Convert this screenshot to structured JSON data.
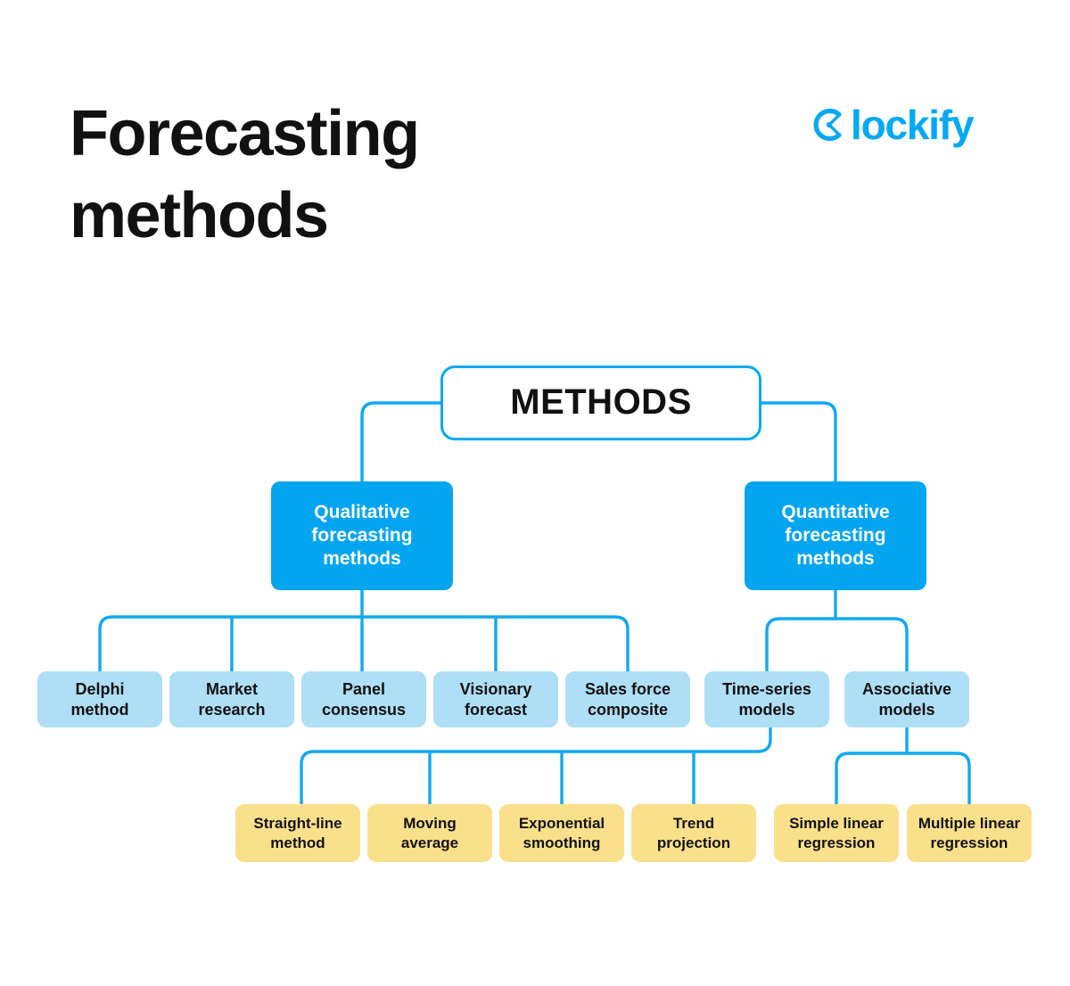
{
  "header": {
    "title": "Forecasting\nmethods",
    "brand": {
      "logo_icon": "clockify-clock-icon",
      "wordmark": "lockify",
      "color": "#03A9F4"
    }
  },
  "theme": {
    "accent_blue": "#03A9F4",
    "node_blue": "#03A5F0",
    "node_light_blue": "#AEDFF7",
    "node_yellow": "#FBE08C",
    "text_dark": "#111111",
    "text_light": "#FFFFFF",
    "background": "#FFFFFF"
  },
  "chart_data": {
    "type": "diagram",
    "diagram_kind": "tree",
    "title": "Forecasting methods",
    "root": "METHODS",
    "levels": [
      {
        "level": 1,
        "style": "outlined-white",
        "nodes": [
          "METHODS"
        ]
      },
      {
        "level": 2,
        "style": "solid-blue",
        "nodes": [
          "Qualitative forecasting methods",
          "Quantitative forecasting methods"
        ]
      },
      {
        "level": 3,
        "style": "light-blue",
        "nodes": [
          "Delphi method",
          "Market research",
          "Panel consensus",
          "Visionary forecast",
          "Sales force composite",
          "Time-series models",
          "Associative models"
        ]
      },
      {
        "level": 4,
        "style": "yellow",
        "nodes": [
          "Straight-line method",
          "Moving average",
          "Exponential smoothing",
          "Trend projection",
          "Simple linear regression",
          "Multiple linear regression"
        ]
      }
    ],
    "edges": [
      {
        "from": "METHODS",
        "to": "Qualitative forecasting methods"
      },
      {
        "from": "METHODS",
        "to": "Quantitative forecasting methods"
      },
      {
        "from": "Qualitative forecasting methods",
        "to": "Delphi method"
      },
      {
        "from": "Qualitative forecasting methods",
        "to": "Market research"
      },
      {
        "from": "Qualitative forecasting methods",
        "to": "Panel consensus"
      },
      {
        "from": "Qualitative forecasting methods",
        "to": "Visionary forecast"
      },
      {
        "from": "Qualitative forecasting methods",
        "to": "Sales force composite"
      },
      {
        "from": "Quantitative forecasting methods",
        "to": "Time-series models"
      },
      {
        "from": "Quantitative forecasting methods",
        "to": "Associative models"
      },
      {
        "from": "Time-series models",
        "to": "Straight-line method"
      },
      {
        "from": "Time-series models",
        "to": "Moving average"
      },
      {
        "from": "Time-series models",
        "to": "Exponential smoothing"
      },
      {
        "from": "Time-series models",
        "to": "Trend projection"
      },
      {
        "from": "Associative models",
        "to": "Simple linear regression"
      },
      {
        "from": "Associative models",
        "to": "Multiple linear regression"
      }
    ]
  },
  "nodes": {
    "root": {
      "label": "METHODS"
    },
    "level2": [
      {
        "label": "Qualitative\nforecasting\nmethods"
      },
      {
        "label": "Quantitative\nforecasting\nmethods"
      }
    ],
    "level3": [
      {
        "label": "Delphi\nmethod"
      },
      {
        "label": "Market\nresearch"
      },
      {
        "label": "Panel\nconsensus"
      },
      {
        "label": "Visionary\nforecast"
      },
      {
        "label": "Sales force\ncomposite"
      },
      {
        "label": "Time-series\nmodels"
      },
      {
        "label": "Associative\nmodels"
      }
    ],
    "level4": [
      {
        "label": "Straight-line\nmethod"
      },
      {
        "label": "Moving\naverage"
      },
      {
        "label": "Exponential\nsmoothing"
      },
      {
        "label": "Trend\nprojection"
      },
      {
        "label": "Simple linear\nregression"
      },
      {
        "label": "Multiple linear\nregression"
      }
    ]
  }
}
